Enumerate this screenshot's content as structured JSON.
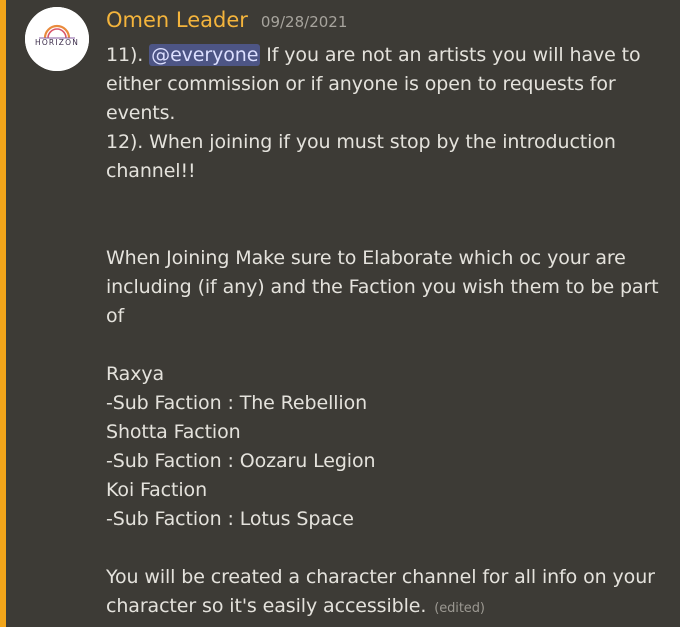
{
  "message": {
    "author": "Omen Leader",
    "timestamp": "09/28/2021",
    "avatar_text": "HORIZON",
    "accent_color": "#f2a51a",
    "author_color": "#f4b43c",
    "mention": "@everyone",
    "lines": {
      "l1_prefix": "11). ",
      "l1_rest": " If you are not an artists you will have to",
      "l2": "either commission or if anyone is open to requests for",
      "l3": "events.",
      "l4": "12). When joining if you must stop by the introduction",
      "l5": "channel!!",
      "l6": "When Joining Make sure to Elaborate which oc your are",
      "l7": "including (if any) and the Faction you wish them to be part",
      "l8": "of",
      "l9": "Raxya",
      "l10": "-Sub Faction : The Rebellion",
      "l11": "Shotta Faction",
      "l12": "-Sub Faction : Oozaru Legion",
      "l13": "Koi Faction",
      "l14": "-Sub Faction : Lotus Space",
      "l15": "You will be created a character channel for all info on your",
      "l16": "character so it's easily accessible."
    },
    "edited_label": "(edited)"
  }
}
